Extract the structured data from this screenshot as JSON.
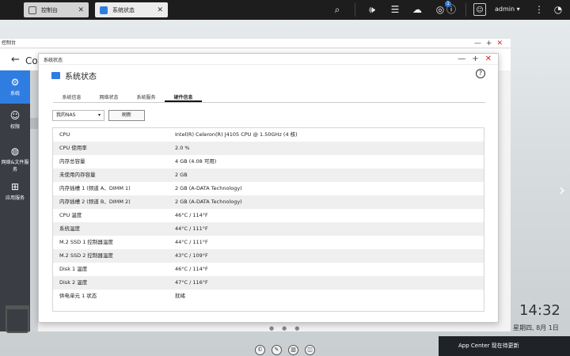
{
  "taskbar": {
    "tabs": [
      {
        "label": "控制台",
        "close": "✕"
      },
      {
        "label": "系统状态",
        "close": "✕"
      }
    ],
    "user": "admin ▾",
    "badge_count": "1"
  },
  "control_panel": {
    "window_title": "控制台",
    "heading": "Co",
    "sidebar": [
      {
        "label": "系统"
      },
      {
        "label": "权限"
      },
      {
        "label": "网络&文件服务"
      },
      {
        "label": "应用服务"
      }
    ]
  },
  "system_status": {
    "window_title": "系统状态",
    "heading": "系统状态",
    "tabs": [
      "系统信息",
      "网络状态",
      "系统服务",
      "硬件信息"
    ],
    "active_tab": 3,
    "device_select": "我的NAS",
    "refresh_label": "刷新",
    "rows": [
      {
        "key": "CPU",
        "value": "Intel(R) Celeron(R) J4105 CPU @ 1.50GHz (4 核)"
      },
      {
        "key": "CPU 使用率",
        "value": "2.0 %"
      },
      {
        "key": "内存总容量",
        "value": "4 GB (4.08 可用)"
      },
      {
        "key": "未使用内存容量",
        "value": "2 GB"
      },
      {
        "key": "内存插槽 1 (频道 A、DIMM 1)",
        "value": "2 GB (A-DATA Technology)"
      },
      {
        "key": "内存插槽 2 (频道 B、DIMM 2)",
        "value": "2 GB (A-DATA Technology)"
      },
      {
        "key": "CPU 温度",
        "value": "46°C / 114°F"
      },
      {
        "key": "系统温度",
        "value": "44°C / 111°F"
      },
      {
        "key": "M.2 SSD 1 控制器温度",
        "value": "44°C / 111°F"
      },
      {
        "key": "M.2 SSD 2 控制器温度",
        "value": "43°C / 109°F"
      },
      {
        "key": "Disk 1 温度",
        "value": "46°C / 114°F"
      },
      {
        "key": "Disk 2 温度",
        "value": "47°C / 116°F"
      },
      {
        "key": "供电单元 1 状态",
        "value": "就绪"
      }
    ]
  },
  "desktop": {
    "clock": "14:32",
    "date": "星期四, 8月 1日",
    "notification": "App Center 现在待更新"
  }
}
